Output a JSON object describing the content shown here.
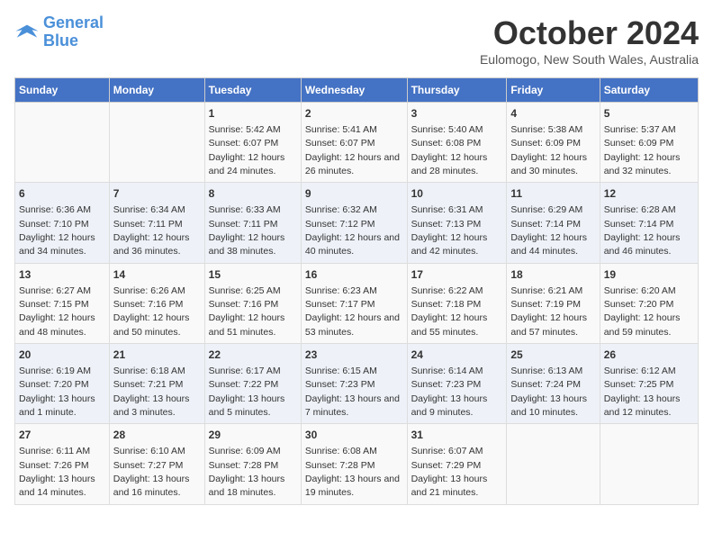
{
  "logo": {
    "line1": "General",
    "line2": "Blue"
  },
  "title": {
    "month": "October 2024",
    "location": "Eulomogo, New South Wales, Australia"
  },
  "columns": [
    "Sunday",
    "Monday",
    "Tuesday",
    "Wednesday",
    "Thursday",
    "Friday",
    "Saturday"
  ],
  "weeks": [
    [
      {
        "day": "",
        "sunrise": "",
        "sunset": "",
        "daylight": ""
      },
      {
        "day": "",
        "sunrise": "",
        "sunset": "",
        "daylight": ""
      },
      {
        "day": "1",
        "sunrise": "Sunrise: 5:42 AM",
        "sunset": "Sunset: 6:07 PM",
        "daylight": "Daylight: 12 hours and 24 minutes."
      },
      {
        "day": "2",
        "sunrise": "Sunrise: 5:41 AM",
        "sunset": "Sunset: 6:07 PM",
        "daylight": "Daylight: 12 hours and 26 minutes."
      },
      {
        "day": "3",
        "sunrise": "Sunrise: 5:40 AM",
        "sunset": "Sunset: 6:08 PM",
        "daylight": "Daylight: 12 hours and 28 minutes."
      },
      {
        "day": "4",
        "sunrise": "Sunrise: 5:38 AM",
        "sunset": "Sunset: 6:09 PM",
        "daylight": "Daylight: 12 hours and 30 minutes."
      },
      {
        "day": "5",
        "sunrise": "Sunrise: 5:37 AM",
        "sunset": "Sunset: 6:09 PM",
        "daylight": "Daylight: 12 hours and 32 minutes."
      }
    ],
    [
      {
        "day": "6",
        "sunrise": "Sunrise: 6:36 AM",
        "sunset": "Sunset: 7:10 PM",
        "daylight": "Daylight: 12 hours and 34 minutes."
      },
      {
        "day": "7",
        "sunrise": "Sunrise: 6:34 AM",
        "sunset": "Sunset: 7:11 PM",
        "daylight": "Daylight: 12 hours and 36 minutes."
      },
      {
        "day": "8",
        "sunrise": "Sunrise: 6:33 AM",
        "sunset": "Sunset: 7:11 PM",
        "daylight": "Daylight: 12 hours and 38 minutes."
      },
      {
        "day": "9",
        "sunrise": "Sunrise: 6:32 AM",
        "sunset": "Sunset: 7:12 PM",
        "daylight": "Daylight: 12 hours and 40 minutes."
      },
      {
        "day": "10",
        "sunrise": "Sunrise: 6:31 AM",
        "sunset": "Sunset: 7:13 PM",
        "daylight": "Daylight: 12 hours and 42 minutes."
      },
      {
        "day": "11",
        "sunrise": "Sunrise: 6:29 AM",
        "sunset": "Sunset: 7:14 PM",
        "daylight": "Daylight: 12 hours and 44 minutes."
      },
      {
        "day": "12",
        "sunrise": "Sunrise: 6:28 AM",
        "sunset": "Sunset: 7:14 PM",
        "daylight": "Daylight: 12 hours and 46 minutes."
      }
    ],
    [
      {
        "day": "13",
        "sunrise": "Sunrise: 6:27 AM",
        "sunset": "Sunset: 7:15 PM",
        "daylight": "Daylight: 12 hours and 48 minutes."
      },
      {
        "day": "14",
        "sunrise": "Sunrise: 6:26 AM",
        "sunset": "Sunset: 7:16 PM",
        "daylight": "Daylight: 12 hours and 50 minutes."
      },
      {
        "day": "15",
        "sunrise": "Sunrise: 6:25 AM",
        "sunset": "Sunset: 7:16 PM",
        "daylight": "Daylight: 12 hours and 51 minutes."
      },
      {
        "day": "16",
        "sunrise": "Sunrise: 6:23 AM",
        "sunset": "Sunset: 7:17 PM",
        "daylight": "Daylight: 12 hours and 53 minutes."
      },
      {
        "day": "17",
        "sunrise": "Sunrise: 6:22 AM",
        "sunset": "Sunset: 7:18 PM",
        "daylight": "Daylight: 12 hours and 55 minutes."
      },
      {
        "day": "18",
        "sunrise": "Sunrise: 6:21 AM",
        "sunset": "Sunset: 7:19 PM",
        "daylight": "Daylight: 12 hours and 57 minutes."
      },
      {
        "day": "19",
        "sunrise": "Sunrise: 6:20 AM",
        "sunset": "Sunset: 7:20 PM",
        "daylight": "Daylight: 12 hours and 59 minutes."
      }
    ],
    [
      {
        "day": "20",
        "sunrise": "Sunrise: 6:19 AM",
        "sunset": "Sunset: 7:20 PM",
        "daylight": "Daylight: 13 hours and 1 minute."
      },
      {
        "day": "21",
        "sunrise": "Sunrise: 6:18 AM",
        "sunset": "Sunset: 7:21 PM",
        "daylight": "Daylight: 13 hours and 3 minutes."
      },
      {
        "day": "22",
        "sunrise": "Sunrise: 6:17 AM",
        "sunset": "Sunset: 7:22 PM",
        "daylight": "Daylight: 13 hours and 5 minutes."
      },
      {
        "day": "23",
        "sunrise": "Sunrise: 6:15 AM",
        "sunset": "Sunset: 7:23 PM",
        "daylight": "Daylight: 13 hours and 7 minutes."
      },
      {
        "day": "24",
        "sunrise": "Sunrise: 6:14 AM",
        "sunset": "Sunset: 7:23 PM",
        "daylight": "Daylight: 13 hours and 9 minutes."
      },
      {
        "day": "25",
        "sunrise": "Sunrise: 6:13 AM",
        "sunset": "Sunset: 7:24 PM",
        "daylight": "Daylight: 13 hours and 10 minutes."
      },
      {
        "day": "26",
        "sunrise": "Sunrise: 6:12 AM",
        "sunset": "Sunset: 7:25 PM",
        "daylight": "Daylight: 13 hours and 12 minutes."
      }
    ],
    [
      {
        "day": "27",
        "sunrise": "Sunrise: 6:11 AM",
        "sunset": "Sunset: 7:26 PM",
        "daylight": "Daylight: 13 hours and 14 minutes."
      },
      {
        "day": "28",
        "sunrise": "Sunrise: 6:10 AM",
        "sunset": "Sunset: 7:27 PM",
        "daylight": "Daylight: 13 hours and 16 minutes."
      },
      {
        "day": "29",
        "sunrise": "Sunrise: 6:09 AM",
        "sunset": "Sunset: 7:28 PM",
        "daylight": "Daylight: 13 hours and 18 minutes."
      },
      {
        "day": "30",
        "sunrise": "Sunrise: 6:08 AM",
        "sunset": "Sunset: 7:28 PM",
        "daylight": "Daylight: 13 hours and 19 minutes."
      },
      {
        "day": "31",
        "sunrise": "Sunrise: 6:07 AM",
        "sunset": "Sunset: 7:29 PM",
        "daylight": "Daylight: 13 hours and 21 minutes."
      },
      {
        "day": "",
        "sunrise": "",
        "sunset": "",
        "daylight": ""
      },
      {
        "day": "",
        "sunrise": "",
        "sunset": "",
        "daylight": ""
      }
    ]
  ]
}
